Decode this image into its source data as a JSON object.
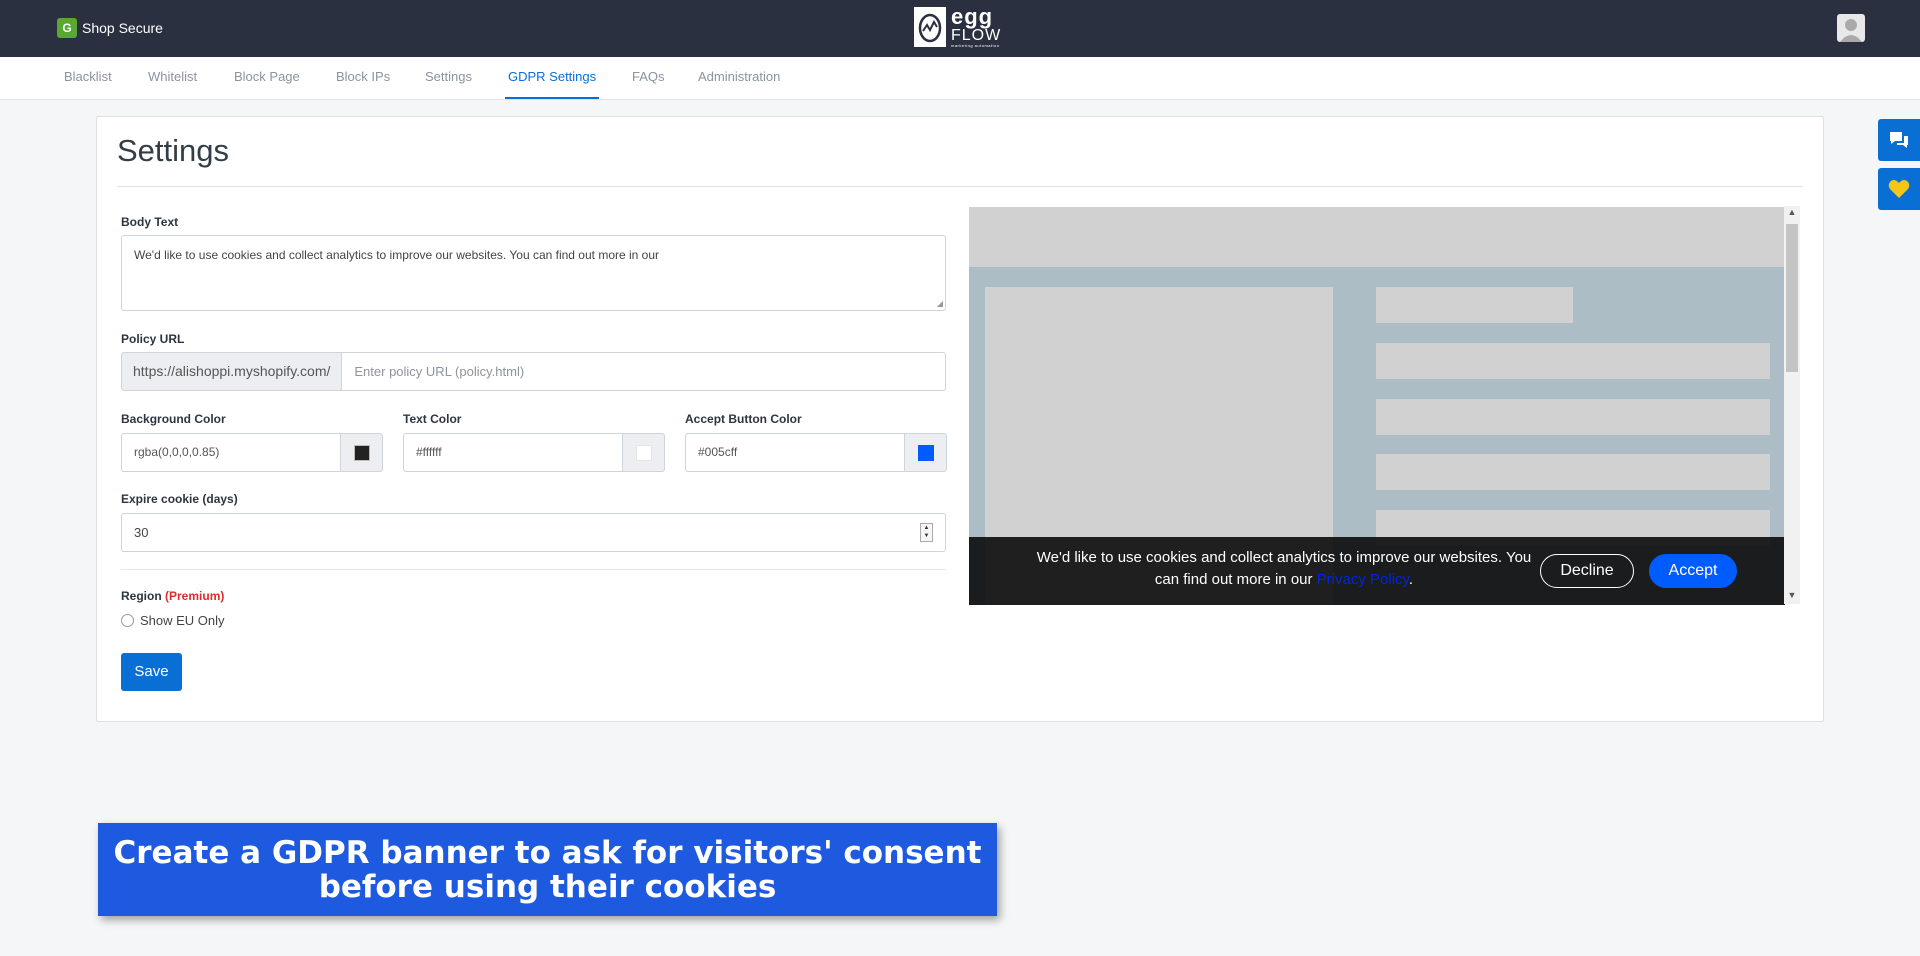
{
  "app": {
    "brand_icon_letter": "G",
    "brand_name": "Shop Secure",
    "logo": {
      "line1": "egg",
      "line2": "FLOW",
      "line3": "marketing automation"
    }
  },
  "nav": {
    "tabs": [
      {
        "label": "Blacklist"
      },
      {
        "label": "Whitelist"
      },
      {
        "label": "Block Page"
      },
      {
        "label": "Block IPs"
      },
      {
        "label": "Settings"
      },
      {
        "label": "GDPR Settings",
        "active": true
      },
      {
        "label": "FAQs"
      },
      {
        "label": "Administration"
      }
    ]
  },
  "page": {
    "title": "Settings"
  },
  "form": {
    "body_text": {
      "label": "Body Text",
      "value": "We'd like to use cookies and collect analytics to improve our websites. You can find out more in our"
    },
    "policy_url": {
      "label": "Policy URL",
      "prefix": "https://alishoppi.myshopify.com/",
      "placeholder": "Enter policy URL (policy.html)"
    },
    "background_color": {
      "label": "Background Color",
      "value": "rgba(0,0,0,0.85)",
      "swatch": "#222222"
    },
    "text_color": {
      "label": "Text Color",
      "value": "#ffffff",
      "swatch": "#ffffff"
    },
    "accept_button_color": {
      "label": "Accept Button Color",
      "value": "#005cff",
      "swatch": "#005cff"
    },
    "expire_cookie": {
      "label": "Expire cookie (days)",
      "value": "30"
    },
    "region": {
      "label": "Region",
      "badge": "(Premium)",
      "option": "Show EU Only"
    },
    "save_label": "Save"
  },
  "preview": {
    "banner_text": "We'd like to use cookies and collect analytics to improve our websites. You can find out more in our",
    "policy_link": "Privacy Policy",
    "decline_label": "Decline",
    "accept_label": "Accept"
  },
  "promo": {
    "line1": "Create a GDPR banner to ask for visitors' consent",
    "line2": "before using their cookies"
  },
  "colors": {
    "primary": "#0a6fd4",
    "topbar": "#2b3041",
    "promo": "#1d5ae0",
    "premium": "#e02b2b"
  }
}
